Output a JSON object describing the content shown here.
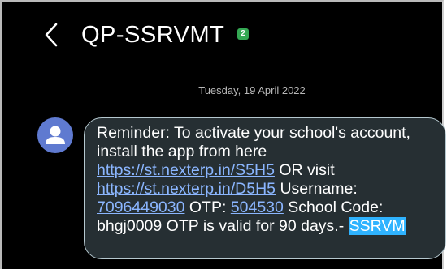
{
  "header": {
    "title": "QP-SSRVMT",
    "sim_badge": "2"
  },
  "thread": {
    "date_separator": "Tuesday, 19 April 2022"
  },
  "message": {
    "text_1": "Reminder: To activate your school's account, install the app from here ",
    "link_1": "https://st.nexterp.in/S5H5",
    "text_2": " OR visit ",
    "link_2": "https://st.nexterp.in/D5H5",
    "text_3": " Username: ",
    "phone": "7096449030",
    "text_4": " OTP: ",
    "otp": "504530",
    "text_5": " School Code: bhgj0009 OTP is valid for 90 days.- ",
    "signature": "SSRVM"
  },
  "colors": {
    "background": "#000000",
    "bubble": "#262f33",
    "link": "#8bb6ff",
    "avatar": "#5f7ad0",
    "sim_badge": "#34a853",
    "highlight": "#2fb3ff"
  },
  "icons": {
    "back": "chevron-left-icon",
    "sim": "sim-2-icon",
    "avatar": "person-icon"
  }
}
